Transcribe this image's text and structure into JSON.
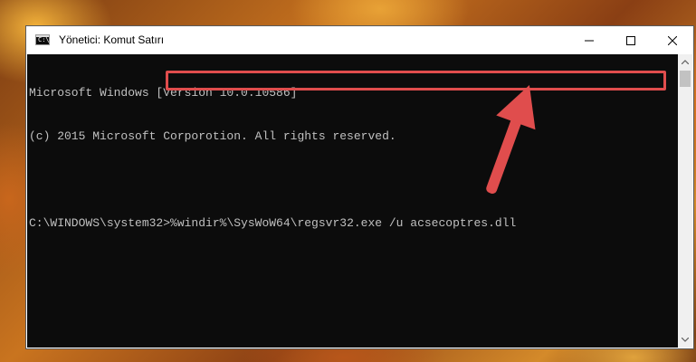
{
  "window": {
    "title": "Yönetici: Komut Satırı",
    "icon_glyph": "C:\\",
    "controls": {
      "minimize": "minimize-icon",
      "maximize": "maximize-icon",
      "close": "close-icon"
    }
  },
  "console": {
    "lines": [
      "Microsoft Windows [Version 10.0.10586]",
      "(c) 2015 Microsoft Corporotion. All rights reserved."
    ],
    "prompt": "C:\\WINDOWS\\system32>",
    "command": "%windir%\\SysWoW64\\regsvr32.exe /u acsecoptres.dll"
  },
  "annotation": {
    "highlight_color": "#e04d4d",
    "arrow_color": "#e04d4d"
  }
}
